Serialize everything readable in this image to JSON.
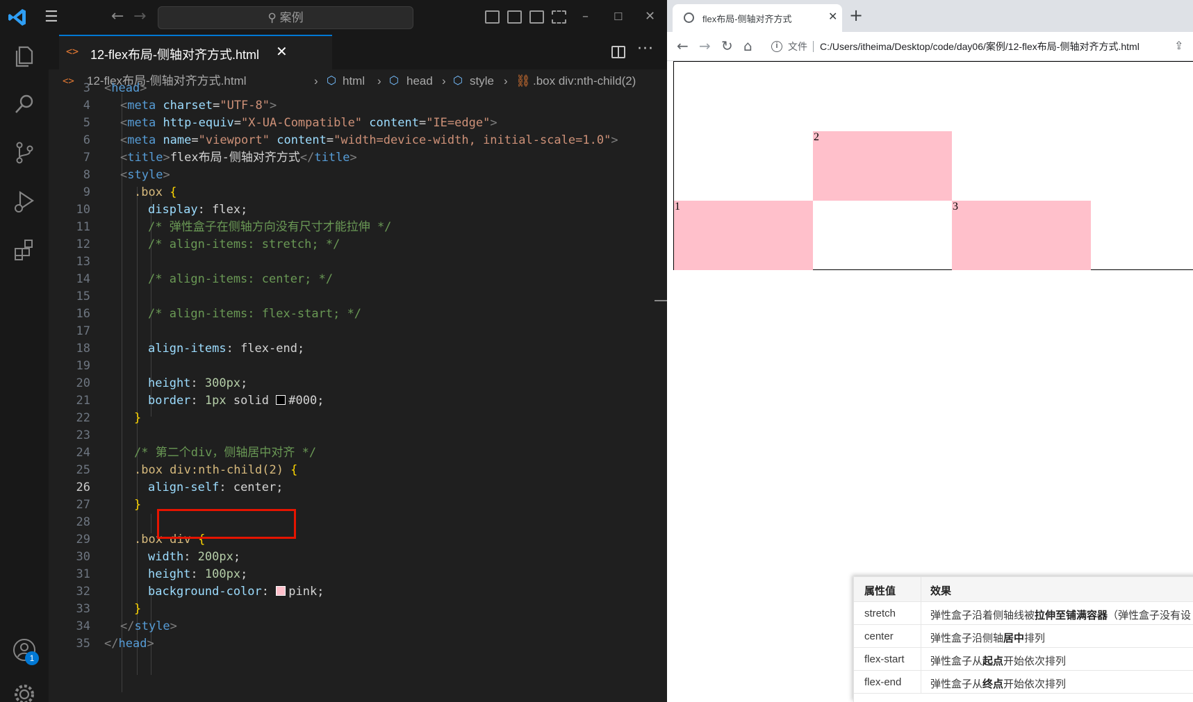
{
  "vscode": {
    "command_center": "案例",
    "tab": {
      "label": "12-flex布局-侧轴对齐方式.html",
      "close": "✕"
    },
    "breadcrumb": [
      "12-flex布局-侧轴对齐方式.html",
      "html",
      "head",
      "style",
      ".box div:nth-child(2)"
    ],
    "active_line": 26,
    "notification_badge": "1",
    "colors": {
      "accent": "#0078d4",
      "highlight": "#e51400",
      "swatch_black": "#000000",
      "swatch_pink": "#ffc0cb"
    },
    "icons": [
      "vscode-logo-icon",
      "menu-icon",
      "files-icon",
      "search-icon",
      "source-control-icon",
      "run-debug-icon",
      "extensions-icon",
      "account-icon",
      "settings-gear-icon"
    ],
    "code_lines": [
      {
        "n": "3",
        "parts": [
          [
            "brk",
            "<"
          ],
          [
            "tag",
            "head"
          ],
          [
            "brk",
            ">"
          ]
        ]
      },
      {
        "n": "4",
        "parts": [
          [
            "brk",
            "<"
          ],
          [
            "tag",
            "meta "
          ],
          [
            "attr",
            "charset"
          ],
          [
            "text",
            "="
          ],
          [
            "str",
            "\"UTF-8\""
          ],
          [
            "brk",
            ">"
          ]
        ]
      },
      {
        "n": "5",
        "parts": [
          [
            "brk",
            "<"
          ],
          [
            "tag",
            "meta "
          ],
          [
            "attr",
            "http-equiv"
          ],
          [
            "text",
            "="
          ],
          [
            "str",
            "\"X-UA-Compatible\" "
          ],
          [
            "attr",
            "content"
          ],
          [
            "text",
            "="
          ],
          [
            "str",
            "\"IE=edge\""
          ],
          [
            "brk",
            ">"
          ]
        ]
      },
      {
        "n": "6",
        "parts": [
          [
            "brk",
            "<"
          ],
          [
            "tag",
            "meta "
          ],
          [
            "attr",
            "name"
          ],
          [
            "text",
            "="
          ],
          [
            "str",
            "\"viewport\" "
          ],
          [
            "attr",
            "content"
          ],
          [
            "text",
            "="
          ],
          [
            "str",
            "\"width=device-width, initial-scale=1.0\""
          ],
          [
            "brk",
            ">"
          ]
        ]
      },
      {
        "n": "7",
        "parts": [
          [
            "brk",
            "<"
          ],
          [
            "tag",
            "title"
          ],
          [
            "brk",
            ">"
          ],
          [
            "text",
            "flex布局-侧轴对齐方式"
          ],
          [
            "brk",
            "</"
          ],
          [
            "tag",
            "title"
          ],
          [
            "brk",
            ">"
          ]
        ]
      },
      {
        "n": "8",
        "parts": [
          [
            "brk",
            "<"
          ],
          [
            "tag",
            "style"
          ],
          [
            "brk",
            ">"
          ]
        ]
      },
      {
        "n": "9",
        "parts": [
          [
            "sel",
            ".box "
          ],
          [
            "brace",
            "{"
          ]
        ]
      },
      {
        "n": "10",
        "parts": [
          [
            "prop",
            "display"
          ],
          [
            "val",
            ": flex;"
          ]
        ]
      },
      {
        "n": "11",
        "parts": [
          [
            "com",
            "/* 弹性盒子在侧轴方向没有尺寸才能拉伸 */"
          ]
        ]
      },
      {
        "n": "12",
        "parts": [
          [
            "com",
            "/* align-items: stretch; */"
          ]
        ]
      },
      {
        "n": "13",
        "parts": []
      },
      {
        "n": "14",
        "parts": [
          [
            "com",
            "/* align-items: center; */"
          ]
        ]
      },
      {
        "n": "15",
        "parts": []
      },
      {
        "n": "16",
        "parts": [
          [
            "com",
            "/* align-items: flex-start; */"
          ]
        ]
      },
      {
        "n": "17",
        "parts": []
      },
      {
        "n": "18",
        "parts": [
          [
            "prop",
            "align-items"
          ],
          [
            "val",
            ": flex-end;"
          ]
        ]
      },
      {
        "n": "19",
        "parts": []
      },
      {
        "n": "20",
        "parts": [
          [
            "prop",
            "height"
          ],
          [
            "val",
            ": "
          ],
          [
            "num",
            "300px"
          ],
          [
            "val",
            ";"
          ]
        ]
      },
      {
        "n": "21",
        "parts": [
          [
            "prop",
            "border"
          ],
          [
            "val",
            ": "
          ],
          [
            "num",
            "1px"
          ],
          [
            "val",
            " solid "
          ],
          [
            "swatch",
            "#000000"
          ],
          [
            "val",
            "#000;"
          ]
        ]
      },
      {
        "n": "22",
        "parts": [
          [
            "brace",
            "}"
          ]
        ]
      },
      {
        "n": "23",
        "parts": []
      },
      {
        "n": "24",
        "parts": [
          [
            "com",
            "/* 第二个div，侧轴居中对齐 */"
          ]
        ]
      },
      {
        "n": "25",
        "parts": [
          [
            "sel",
            ".box div:nth-child(2) "
          ],
          [
            "brace",
            "{"
          ]
        ]
      },
      {
        "n": "26",
        "parts": [
          [
            "prop",
            "align-self"
          ],
          [
            "val",
            ": center;"
          ]
        ]
      },
      {
        "n": "27",
        "parts": [
          [
            "brace",
            "}"
          ]
        ]
      },
      {
        "n": "28",
        "parts": []
      },
      {
        "n": "29",
        "parts": [
          [
            "sel",
            ".box div "
          ],
          [
            "brace",
            "{"
          ]
        ]
      },
      {
        "n": "30",
        "parts": [
          [
            "prop",
            "width"
          ],
          [
            "val",
            ": "
          ],
          [
            "num",
            "200px"
          ],
          [
            "val",
            ";"
          ]
        ]
      },
      {
        "n": "31",
        "parts": [
          [
            "prop",
            "height"
          ],
          [
            "val",
            ": "
          ],
          [
            "num",
            "100px"
          ],
          [
            "val",
            ";"
          ]
        ]
      },
      {
        "n": "32",
        "parts": [
          [
            "prop",
            "background-color"
          ],
          [
            "val",
            ": "
          ],
          [
            "swatch",
            "#ffc0cb"
          ],
          [
            "val",
            "pink;"
          ]
        ]
      },
      {
        "n": "33",
        "parts": [
          [
            "brace",
            "}"
          ]
        ]
      },
      {
        "n": "34",
        "parts": [
          [
            "brk",
            "</"
          ],
          [
            "tag",
            "style"
          ],
          [
            "brk",
            ">"
          ]
        ]
      },
      {
        "n": "35",
        "parts": [
          [
            "brk",
            "</"
          ],
          [
            "tag",
            "head"
          ],
          [
            "brk",
            ">"
          ]
        ]
      }
    ]
  },
  "browser": {
    "tab_title": "flex布局-侧轴对齐方式",
    "tab_close": "✕",
    "new_tab": "+",
    "address": {
      "scheme_label": "文件",
      "url": "C:/Users/itheima/Desktop/code/day06/案例/12-flex布局-侧轴对齐方式.html"
    },
    "icons": [
      "back-icon",
      "forward-icon",
      "reload-icon",
      "home-icon",
      "info-icon",
      "share-icon"
    ],
    "demo_items": [
      "1",
      "2",
      "3"
    ],
    "demo_color": "#ffc0cb",
    "table": {
      "headers": [
        "属性值",
        "效果"
      ],
      "rows": [
        {
          "value": "stretch",
          "effect_pre": "弹性盒子沿着侧轴线被",
          "effect_bold": "拉伸至铺满容器",
          "effect_post": "（弹性盒子没有设"
        },
        {
          "value": "center",
          "effect_pre": "弹性盒子沿侧轴",
          "effect_bold": "居中",
          "effect_post": "排列"
        },
        {
          "value": "flex-start",
          "effect_pre": "弹性盒子从",
          "effect_bold": "起点",
          "effect_post": "开始依次排列"
        },
        {
          "value": "flex-end",
          "effect_pre": "弹性盒子从",
          "effect_bold": "终点",
          "effect_post": "开始依次排列"
        }
      ]
    }
  }
}
